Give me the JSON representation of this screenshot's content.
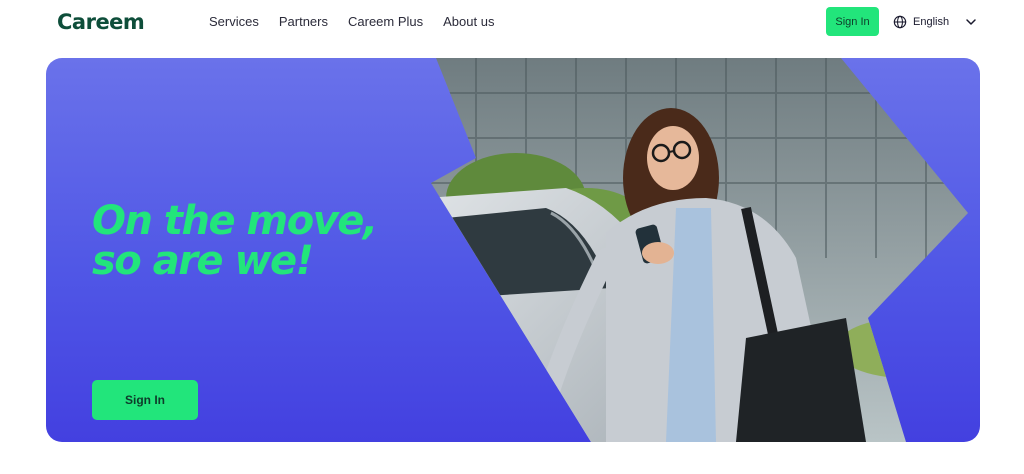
{
  "brand": {
    "name": "Careem"
  },
  "nav": {
    "items": [
      {
        "label": "Services"
      },
      {
        "label": "Partners"
      },
      {
        "label": "Careem Plus"
      },
      {
        "label": "About us"
      }
    ]
  },
  "header": {
    "signin_label": "Sign In",
    "language": {
      "selected": "English",
      "icon": "globe-icon",
      "dropdown_icon": "chevron-down-icon"
    }
  },
  "hero": {
    "headline_line1": "On the move,",
    "headline_line2": "so are we!",
    "signin_label": "Sign In",
    "image": "woman-with-phone-opening-car-door"
  },
  "colors": {
    "accent": "#22e57b",
    "logo": "#0e4e3a",
    "hero_top": "#6a72ea",
    "hero_bottom": "#4340e0"
  }
}
